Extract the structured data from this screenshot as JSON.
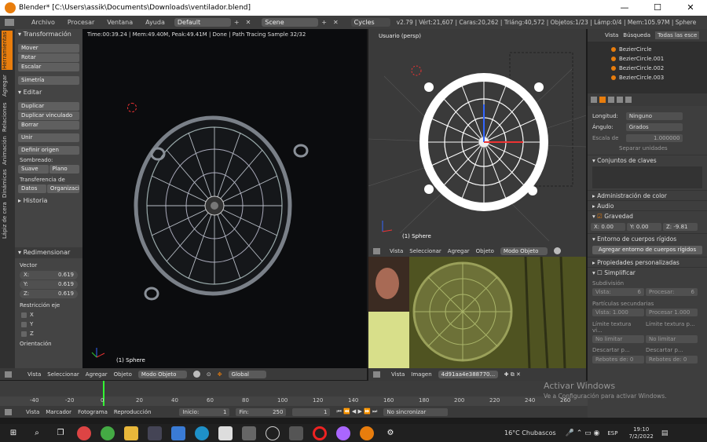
{
  "window": {
    "title": "Blender* [C:\\Users\\assik\\Documents\\Downloads\\ventilador.blend]",
    "btn_min": "—",
    "btn_max": "☐",
    "btn_close": "✕"
  },
  "menu": {
    "items": [
      "Archivo",
      "Procesar",
      "Ventana",
      "Ayuda"
    ],
    "layout": "Default",
    "scene": "Scene",
    "engine": "Cycles",
    "stats": "v2.79 | Vért:21,607 | Caras:20,262 | Triáng:40,572 | Objetos:1/23 | Lámp:0/4 | Mem:105.97M | Sphere"
  },
  "tabs": [
    "Herramientas",
    "Agregar",
    "Relaciones",
    "Animación",
    "Dinámicas",
    "Lápiz de cera"
  ],
  "toolshelf": {
    "transform": "Transformación",
    "move": "Mover",
    "rotate": "Rotar",
    "scale": "Escalar",
    "mirror": "Simetría",
    "edit": "Editar",
    "duplicate": "Duplicar",
    "dup_linked": "Duplicar vinculado",
    "delete": "Borrar",
    "join": "Unir",
    "origin": "Definir origen",
    "shading": "Sombreado:",
    "smooth": "Suave",
    "flat": "Plano",
    "transfer": "Transferencia de datos:",
    "data": "Datos",
    "organize": "Organizaci",
    "history": "Historia",
    "resize": "Redimensionar",
    "vector": "Vector",
    "x": "X:",
    "y": "Y:",
    "z": "Z:",
    "xv": "0.619",
    "yv": "0.619",
    "zv": "0.619",
    "constraint": "Restricción eje",
    "cx": "X",
    "cy": "Y",
    "cz": "Z",
    "orient": "Orientación"
  },
  "render": {
    "status": "Time:00:39.24 | Mem:49.40M, Peak:49.41M | Done | Path Tracing Sample 32/32",
    "label": "(1) Sphere"
  },
  "viewport": {
    "name": "Usuario (persp)",
    "label": "(1) Sphere"
  },
  "hdr1": [
    "Vista",
    "Seleccionar",
    "Agregar",
    "Objeto",
    "Modo Objeto",
    "Global"
  ],
  "hdr2": [
    "Vista",
    "Seleccionar",
    "Agregar",
    "Objeto",
    "Modo Objeto"
  ],
  "hdr3": [
    "Vista",
    "Imagen",
    "4d91aa4e388770..."
  ],
  "outliner": {
    "tabs": [
      "Vista",
      "Búsqueda",
      "Todas las esce"
    ],
    "items": [
      "BezierCircle",
      "BezierCircle.001",
      "BezierCircle.002",
      "BezierCircle.003"
    ]
  },
  "props": {
    "length": "Longitud:",
    "length_v": "Ninguno",
    "angle": "Ángulo:",
    "angle_v": "Grados",
    "scale": "Escala de",
    "scale_v": "1.000000",
    "sep": "Separar unidades",
    "keysets": "Conjuntos de claves",
    "color": "Administración de color",
    "audio": "Audio",
    "gravity": "Gravedad",
    "gx": "X: 0.00",
    "gy": "Y: 0.00",
    "gz": "Z: -9.81",
    "rigid": "Entorno de cuerpos rígidos",
    "rigid_btn": "Agregar entorno de cuerpos rígidos",
    "custom": "Propiedades personalizadas",
    "simplify": "Simplificar",
    "subdiv": "Subdivisión",
    "view": "Vista:",
    "view_v": "6",
    "proc": "Procesar:",
    "proc_v": "6",
    "particles": "Partículas secundarias",
    "vista1": "Vista: 1.000",
    "proc1": "Procesar 1.000",
    "tex": "Límite textura vi...",
    "texp": "Límite textura p...",
    "nolim": "No limitar",
    "nolim2": "No limitar",
    "discard": "Descartar p...",
    "discard2": "Descartar p...",
    "bounces": "Rebotes de: 0",
    "bounces2": "Rebotes de: 0"
  },
  "timeline": {
    "ticks": [
      "-40",
      "-20",
      "0",
      "20",
      "40",
      "60",
      "80",
      "100",
      "120",
      "140",
      "160",
      "180",
      "200",
      "220",
      "240",
      "260"
    ],
    "pb": [
      "Vista",
      "Marcador",
      "Fotograma",
      "Reproducción"
    ],
    "start": "Inicio:",
    "start_v": "1",
    "end": "Fin:",
    "end_v": "250",
    "cur": "1",
    "sync": "No sincronizar"
  },
  "watermark": {
    "l1": "Activar Windows",
    "l2": "Ve a Configuración para activar Windows."
  },
  "taskbar": {
    "weather": "16°C  Chubascos",
    "lang": "ESP",
    "time": "19:10",
    "date": "7/2/2022"
  }
}
